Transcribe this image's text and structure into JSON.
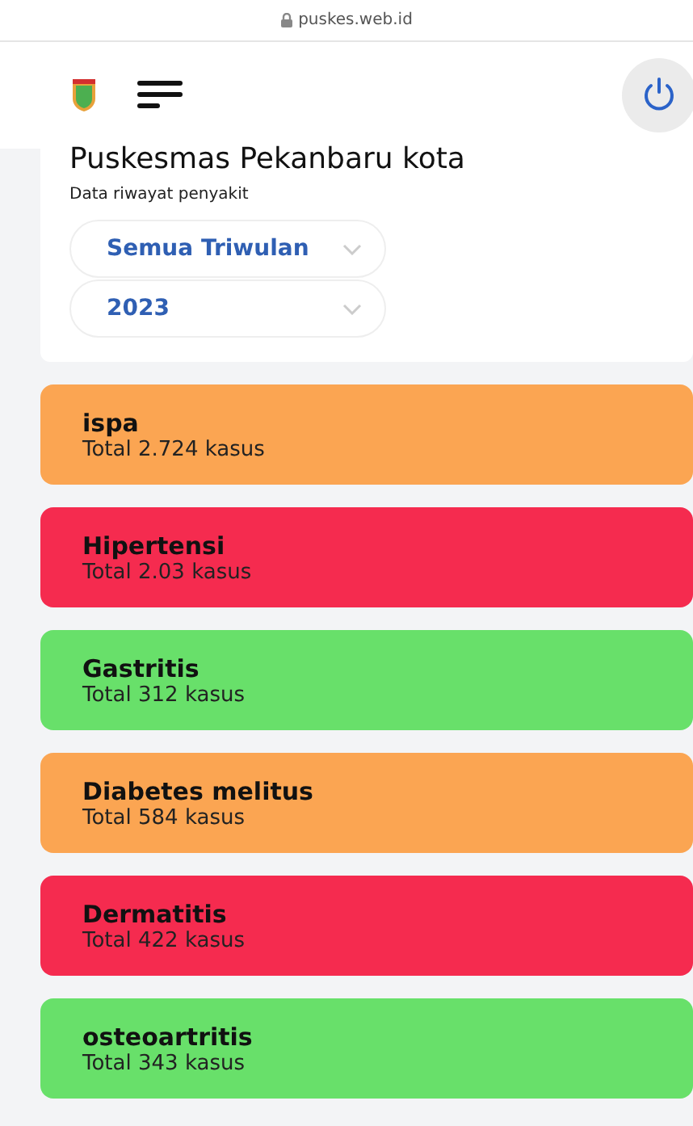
{
  "browser": {
    "url": "puskes.web.id"
  },
  "header": {
    "title": "Puskesmas Pekanbaru kota",
    "subtitle": "Data riwayat penyakit",
    "filters": [
      {
        "value": "Semua Triwulan"
      },
      {
        "value": "2023"
      }
    ]
  },
  "diseases": [
    {
      "name": "ispa",
      "total": "Total 2.724 kasus",
      "color": "#fba552"
    },
    {
      "name": "Hipertensi",
      "total": "Total 2.03 kasus",
      "color": "#f52b4f"
    },
    {
      "name": "Gastritis",
      "total": "Total 312 kasus",
      "color": "#68e06a"
    },
    {
      "name": "Diabetes melitus",
      "total": "Total 584 kasus",
      "color": "#fba552"
    },
    {
      "name": "Dermatitis",
      "total": "Total 422 kasus",
      "color": "#f52b4f"
    },
    {
      "name": "osteoartritis",
      "total": "Total 343 kasus",
      "color": "#68e06a"
    }
  ]
}
